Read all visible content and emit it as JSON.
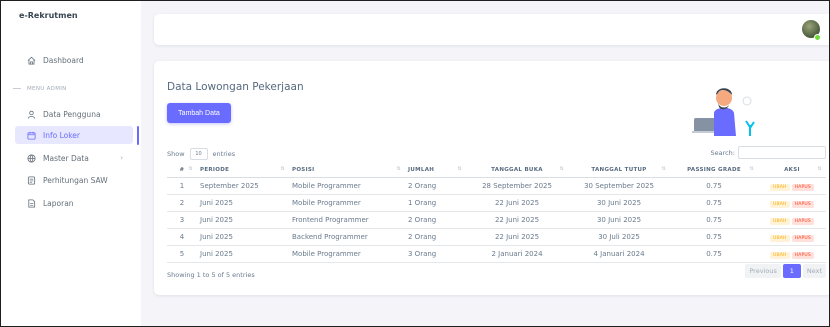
{
  "sidebar": {
    "brand": "e-Rekrutmen",
    "items": [
      {
        "label": "Dashboard",
        "icon": "home-icon"
      },
      {
        "label": "Data Pengguna",
        "icon": "user-icon"
      },
      {
        "label": "Info Loker",
        "icon": "calendar-icon"
      },
      {
        "label": "Master Data",
        "icon": "globe-icon"
      },
      {
        "label": "Perhitungan SAW",
        "icon": "document-icon"
      },
      {
        "label": "Laporan",
        "icon": "report-icon"
      }
    ],
    "menu_header": "MENU ADMIN",
    "expand_glyph": "›"
  },
  "colors": {
    "accent": "#696cff",
    "warning": "#ffab00",
    "danger": "#ff3e1d"
  },
  "main": {
    "title": "Data Lowongan Pekerjaan",
    "add_button": "Tambah Data",
    "show_label": "Show",
    "entries_value": "10",
    "entries_label": "entries",
    "search_label": "Search:",
    "table": {
      "headers": [
        "#",
        "PERIODE",
        "POSISI",
        "JUMLAH",
        "TANGGAL BUKA",
        "TANGGAL TUTUP",
        "PASSING GRADE",
        "AKSI"
      ],
      "rows": [
        {
          "no": "1",
          "periode": "September 2025",
          "posisi": "Mobile Programmer",
          "jumlah": "2 Orang",
          "buka": "28 September 2025",
          "tutup": "30 September 2025",
          "grade": "0.75"
        },
        {
          "no": "2",
          "periode": "Juni 2025",
          "posisi": "Mobile Programmer",
          "jumlah": "1 Orang",
          "buka": "22 Juni 2025",
          "tutup": "30 Juni 2025",
          "grade": "0.75"
        },
        {
          "no": "3",
          "periode": "Juni 2025",
          "posisi": "Frontend Programmer",
          "jumlah": "2 Orang",
          "buka": "22 Juni 2025",
          "tutup": "30 Juni 2025",
          "grade": "0.75"
        },
        {
          "no": "4",
          "periode": "Juni 2025",
          "posisi": "Backend Programmer",
          "jumlah": "2 Orang",
          "buka": "22 Juni 2025",
          "tutup": "30 Juli 2025",
          "grade": "0.75"
        },
        {
          "no": "5",
          "periode": "Juni 2025",
          "posisi": "Mobile Programmer",
          "jumlah": "3 Orang",
          "buka": "2 Januari 2024",
          "tutup": "4 Januari 2024",
          "grade": "0.75"
        }
      ],
      "edit_label": "UBAH",
      "delete_label": "HAPUS"
    },
    "showing_text": "Showing 1 to 5 of 5 entries",
    "pagination": {
      "previous": "Previous",
      "current": "1",
      "next": "Next"
    }
  }
}
